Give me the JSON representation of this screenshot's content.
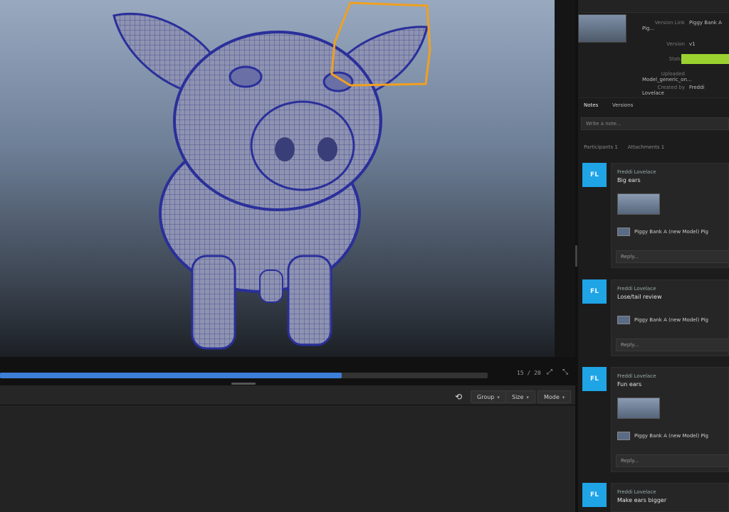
{
  "viewer": {
    "progress": 0.7,
    "timecode": "15 / 20",
    "annotation_color": "#f0a020"
  },
  "controls": {
    "loop_icon": "loop-icon",
    "buttons": [
      {
        "label": "Group",
        "icon": "chevron-down-icon"
      },
      {
        "label": "Size",
        "icon": "chevron-down-icon"
      },
      {
        "label": "Mode",
        "icon": "chevron-down-icon"
      }
    ]
  },
  "details": {
    "fields": [
      {
        "key": "Version Link",
        "value": "Piggy Bank A Pig..."
      },
      {
        "key": "Version",
        "value": "v1"
      },
      {
        "key": "Status",
        "value": ""
      },
      {
        "key": "Uploaded",
        "value": "Model_generic_on..."
      },
      {
        "key": "Created by",
        "value": "Freddi Lovelace"
      }
    ],
    "status_color": "#9bd22f"
  },
  "tabs": {
    "notes": "Notes",
    "versions": "Versions"
  },
  "note_input": {
    "placeholder": "Write a note..."
  },
  "filters": {
    "participants": "Participants 1",
    "attachments": "Attachments 1"
  },
  "notes": [
    {
      "avatar": "FL",
      "author": "Freddi Lovelace",
      "body": "Big ears",
      "has_thumb": true,
      "version": "Piggy Bank A (new Model) Pig",
      "reply": "Reply..."
    },
    {
      "avatar": "FL",
      "author": "Freddi Lovelace",
      "body": "Lose/tail review",
      "has_thumb": false,
      "version": "Piggy Bank A (new Model) Pig",
      "reply": "Reply..."
    },
    {
      "avatar": "FL",
      "author": "Freddi Lovelace",
      "body": "Fun ears",
      "has_thumb": true,
      "version": "Piggy Bank A (new Model) Pig",
      "reply": "Reply..."
    },
    {
      "avatar": "FL",
      "author": "Freddi Lovelace",
      "body": "Make ears bigger",
      "has_thumb": false,
      "version": "",
      "reply": ""
    }
  ]
}
